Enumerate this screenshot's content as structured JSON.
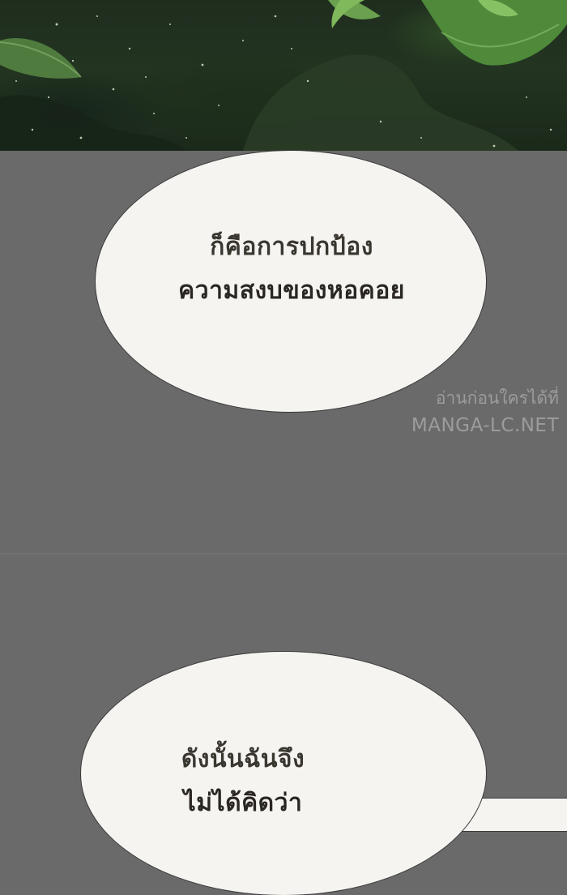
{
  "bubble_top": {
    "lines": [
      "ก็คือการปกป้อง",
      "ความสงบของหอคอย"
    ]
  },
  "watermark": {
    "line1": "อ่านก่อนใครได้ที่",
    "line2": "MANGA-LC.NET"
  },
  "bubble_bottom": {
    "lines": [
      "ดังนั้นฉันจึง",
      "ไม่ได้คิดว่า"
    ]
  }
}
